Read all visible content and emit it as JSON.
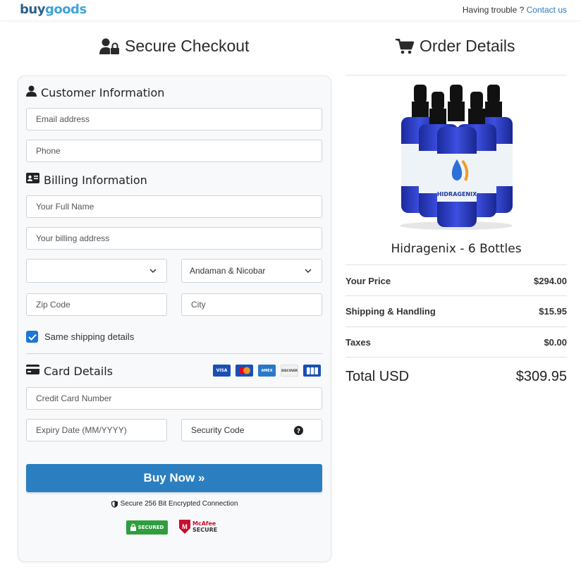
{
  "header": {
    "logo_part1": "buy",
    "logo_part2": "goods",
    "trouble_text": "Having trouble ?",
    "contact_link": "Contact us"
  },
  "checkout": {
    "title": "Secure Checkout",
    "customer_heading": "Customer Information",
    "email_placeholder": "Email address",
    "phone_placeholder": "Phone",
    "billing_heading": "Billing Information",
    "full_name_placeholder": "Your Full Name",
    "billing_address_placeholder": "Your billing address",
    "country_selected": "",
    "state_selected": "Andaman & Nicobar",
    "zip_placeholder": "Zip Code",
    "city_placeholder": "City",
    "same_shipping_label": "Same shipping details",
    "same_shipping_checked": true,
    "card_heading": "Card Details",
    "card_brands": [
      "VISA",
      "MC",
      "AMEX",
      "DISCOVER",
      "JCB"
    ],
    "card_number_placeholder": "Credit Card Number",
    "expiry_placeholder": "Expiry Date (MM/YYYY)",
    "security_code_placeholder": "Security Code",
    "buy_button": "Buy Now »",
    "secure_connection": "Secure 256 Bit Encrypted Connection",
    "badge_secured": "SECURED",
    "badge_mcafee_line1": "McAfee",
    "badge_mcafee_line2": "SECURE"
  },
  "order": {
    "title": "Order Details",
    "product_name": "Hidragenix - 6 Bottles",
    "product_label": "HIDRAGENIX",
    "lines": [
      {
        "label": "Your Price",
        "value": "$294.00"
      },
      {
        "label": "Shipping & Handling",
        "value": "$15.95"
      },
      {
        "label": "Taxes",
        "value": "$0.00"
      }
    ],
    "total_label": "Total USD",
    "total_value": "$309.95"
  },
  "colors": {
    "accent": "#2b7fc0",
    "checkbox": "#1f75d6",
    "link": "#2b7bb9"
  }
}
